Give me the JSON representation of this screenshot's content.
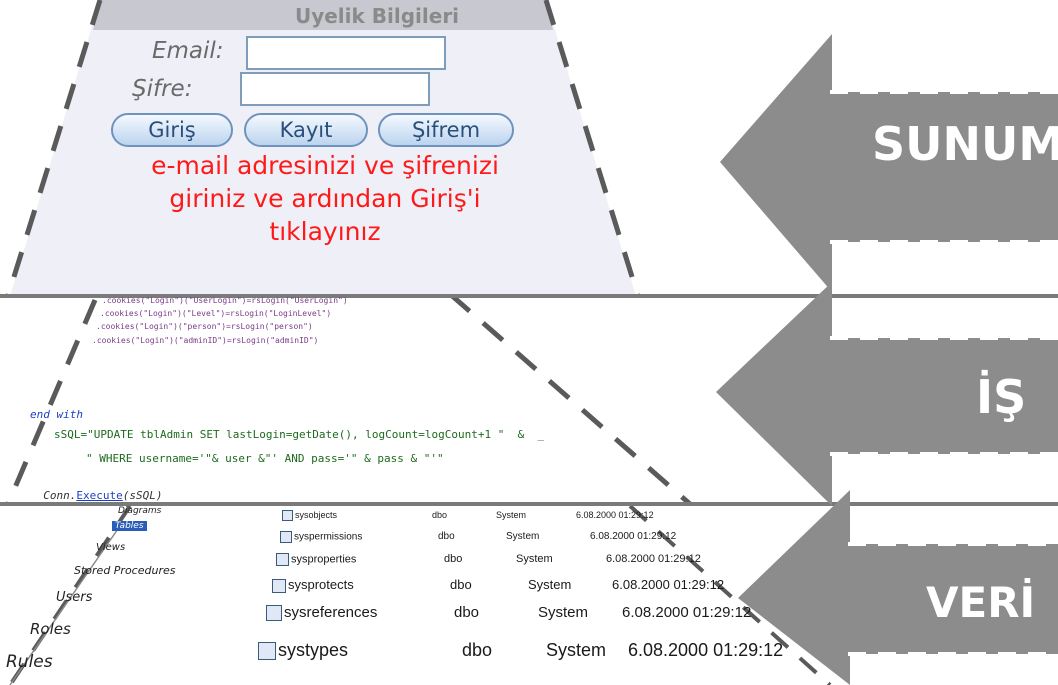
{
  "login_form": {
    "title": "Uyelik Bilgileri",
    "email_label": "Email:",
    "password_label": "Şifre:",
    "email_value": "",
    "password_value": "",
    "buttons": {
      "login": "Giriş",
      "register": "Kayıt",
      "forgot": "Şifrem"
    },
    "hint_lines": [
      "e-mail adresinizi ve şifrenizi",
      "giriniz ve ardından Giriş'i",
      "tıklayınız"
    ]
  },
  "code": {
    "small_lines": [
      ".cookies(\"Login\")(\"UserLogin\")=rsLogin(\"UserLogin\")",
      ".cookies(\"Login\")(\"Level\")=rsLogin(\"LoginLevel\")",
      ".cookies(\"Login\")(\"person\")=rsLogin(\"person\")",
      ".cookies(\"Login\")(\"adminID\")=rsLogin(\"adminID\")"
    ],
    "end_with": "end with",
    "sql_line": "sSQL=\"UPDATE tblAdmin SET lastLogin=getDate(), logCount=logCount+1 \"  &  _",
    "where_line": "\" WHERE username='\"& user &\"' AND pass='\" & pass & \"'\"",
    "exec_object": "Conn.",
    "exec_method": "Execute",
    "exec_args": "(sSQL)"
  },
  "object_explorer": {
    "tree": [
      "Diagrams",
      "Tables",
      "Views",
      "Stored Procedures",
      "Users",
      "Roles",
      "Rules"
    ],
    "rows": [
      {
        "name": "sysobjects",
        "owner": "dbo",
        "type": "System",
        "created": "6.08.2000 01:29:12"
      },
      {
        "name": "syspermissions",
        "owner": "dbo",
        "type": "System",
        "created": "6.08.2000 01:29:12"
      },
      {
        "name": "sysproperties",
        "owner": "dbo",
        "type": "System",
        "created": "6.08.2000 01:29:12"
      },
      {
        "name": "sysprotects",
        "owner": "dbo",
        "type": "System",
        "created": "6.08.2000 01:29:12"
      },
      {
        "name": "sysreferences",
        "owner": "dbo",
        "type": "System",
        "created": "6.08.2000 01:29:12"
      },
      {
        "name": "systypes",
        "owner": "dbo",
        "type": "System",
        "created": "6.08.2000 01:29:12"
      }
    ]
  },
  "layers": [
    {
      "label": "SUNUM",
      "color": "#8c8c8c"
    },
    {
      "label": "İŞ",
      "color": "#8c8c8c"
    },
    {
      "label": "VERİ",
      "color": "#8c8c8c"
    }
  ],
  "colors": {
    "panel": "#efeff7",
    "divider": "#7a7a7a",
    "arrow": "#8c8c8c",
    "hint_text": "#ff1a1a"
  }
}
